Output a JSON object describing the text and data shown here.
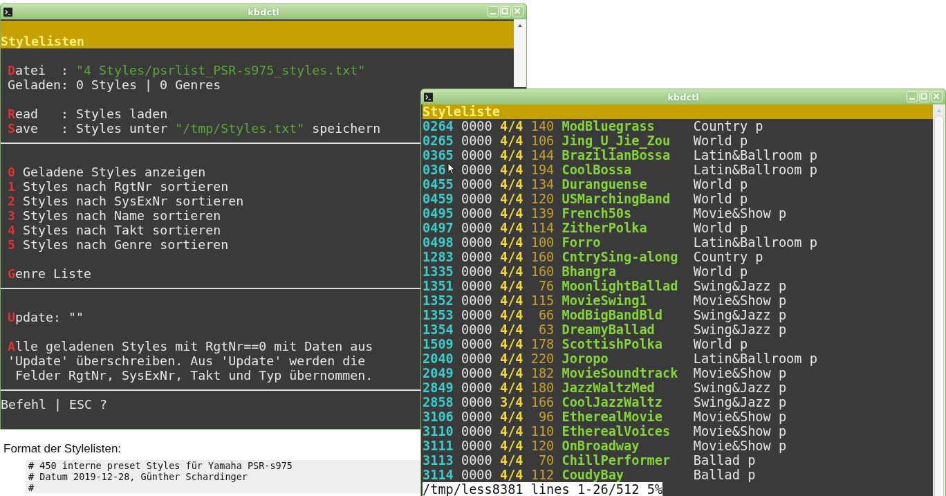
{
  "left_window": {
    "title": "kbdctl",
    "header": "Stylelisten",
    "sections": [
      {
        "groups": [
          [
            [
              {
                "kind": "hotkey",
                "text": "D"
              },
              {
                "kind": "text",
                "text": "atei  : "
              },
              {
                "kind": "path",
                "text": "\"4 Styles/psrlist_PSR-s975_styles.txt\""
              }
            ],
            [
              {
                "kind": "text",
                "text": "Geladen: 0 Styles | 0 Genres"
              }
            ]
          ],
          [
            [
              {
                "kind": "hotkey",
                "text": "R"
              },
              {
                "kind": "text",
                "text": "ead   : Styles laden"
              }
            ],
            [
              {
                "kind": "hotkey",
                "text": "S"
              },
              {
                "kind": "text",
                "text": "ave   : Styles unter "
              },
              {
                "kind": "path",
                "text": "\"/tmp/Styles.txt\""
              },
              {
                "kind": "text",
                "text": " speichern"
              }
            ]
          ]
        ]
      },
      {
        "groups": [
          [
            [
              {
                "kind": "hotkey",
                "text": "0"
              },
              {
                "kind": "text",
                "text": " Geladene Styles anzeigen"
              }
            ],
            [
              {
                "kind": "hotkey",
                "text": "1"
              },
              {
                "kind": "text",
                "text": " Styles nach RgtNr sortieren"
              }
            ],
            [
              {
                "kind": "hotkey",
                "text": "2"
              },
              {
                "kind": "text",
                "text": " Styles nach SysExNr sortieren"
              }
            ],
            [
              {
                "kind": "hotkey",
                "text": "3"
              },
              {
                "kind": "text",
                "text": " Styles nach Name sortieren"
              }
            ],
            [
              {
                "kind": "hotkey",
                "text": "4"
              },
              {
                "kind": "text",
                "text": " Styles nach Takt sortieren"
              }
            ],
            [
              {
                "kind": "hotkey",
                "text": "5"
              },
              {
                "kind": "text",
                "text": " Styles nach Genre sortieren"
              }
            ]
          ],
          [
            [
              {
                "kind": "hotkey",
                "text": "G"
              },
              {
                "kind": "text",
                "text": "enre Liste"
              }
            ]
          ]
        ]
      },
      {
        "groups": [
          [
            [
              {
                "kind": "hotkey",
                "text": "U"
              },
              {
                "kind": "text",
                "text": "pdate: \"\""
              }
            ]
          ],
          [
            [
              {
                "kind": "hotkey",
                "text": "A"
              },
              {
                "kind": "text",
                "text": "lle geladenen Styles mit RgtNr==0 mit Daten aus"
              }
            ],
            [
              {
                "kind": "text",
                "text": "'Update' überschreiben. Aus 'Update' werden die"
              }
            ],
            [
              {
                "kind": "text",
                "text": " Felder RgtNr, SysExNr, Takt und Typ übernommen."
              }
            ]
          ]
        ]
      }
    ],
    "prompt": "Befehl | ESC ?"
  },
  "right_window": {
    "title": "kbdctl",
    "header": "Styleliste",
    "rows": [
      {
        "id": "0264",
        "sysex": "0000",
        "takt": "4/4",
        "tempo": "140",
        "name": "ModBluegrass",
        "genre": "Country p"
      },
      {
        "id": "0265",
        "sysex": "0000",
        "takt": "4/4",
        "tempo": "106",
        "name": "Jing_U_Jie_Zou",
        "genre": "World p"
      },
      {
        "id": "0365",
        "sysex": "0000",
        "takt": "4/4",
        "tempo": "144",
        "name": "BrazilianBossa",
        "genre": "Latin&Ballroom p"
      },
      {
        "id": "036",
        "sysex": "0000",
        "takt": "4/4",
        "tempo": "194",
        "name": "CoolBossa",
        "genre": "Latin&Ballroom p"
      },
      {
        "id": "0455",
        "sysex": "0000",
        "takt": "4/4",
        "tempo": "134",
        "name": "Duranguense",
        "genre": "World p"
      },
      {
        "id": "0459",
        "sysex": "0000",
        "takt": "4/4",
        "tempo": "120",
        "name": "USMarchingBand",
        "genre": "World p"
      },
      {
        "id": "0495",
        "sysex": "0000",
        "takt": "4/4",
        "tempo": "139",
        "name": "French50s",
        "genre": "Movie&Show p"
      },
      {
        "id": "0497",
        "sysex": "0000",
        "takt": "4/4",
        "tempo": "114",
        "name": "ZitherPolka",
        "genre": "World p"
      },
      {
        "id": "0498",
        "sysex": "0000",
        "takt": "4/4",
        "tempo": "100",
        "name": "Forro",
        "genre": "Latin&Ballroom p"
      },
      {
        "id": "1283",
        "sysex": "0000",
        "takt": "4/4",
        "tempo": "160",
        "name": "CntrySing-along",
        "genre": "Country p"
      },
      {
        "id": "1335",
        "sysex": "0000",
        "takt": "4/4",
        "tempo": "160",
        "name": "Bhangra",
        "genre": "World p"
      },
      {
        "id": "1351",
        "sysex": "0000",
        "takt": "4/4",
        "tempo": "76",
        "name": "MoonlightBallad",
        "genre": "Swing&Jazz p"
      },
      {
        "id": "1352",
        "sysex": "0000",
        "takt": "4/4",
        "tempo": "115",
        "name": "MovieSwing1",
        "genre": "Movie&Show p"
      },
      {
        "id": "1353",
        "sysex": "0000",
        "takt": "4/4",
        "tempo": "66",
        "name": "ModBigBandBld",
        "genre": "Swing&Jazz p"
      },
      {
        "id": "1354",
        "sysex": "0000",
        "takt": "4/4",
        "tempo": "63",
        "name": "DreamyBallad",
        "genre": "Swing&Jazz p"
      },
      {
        "id": "1509",
        "sysex": "0000",
        "takt": "4/4",
        "tempo": "178",
        "name": "ScottishPolka",
        "genre": "World p"
      },
      {
        "id": "2040",
        "sysex": "0000",
        "takt": "4/4",
        "tempo": "220",
        "name": "Joropo",
        "genre": "Latin&Ballroom p"
      },
      {
        "id": "2049",
        "sysex": "0000",
        "takt": "4/4",
        "tempo": "182",
        "name": "MovieSoundtrack",
        "genre": "Movie&Show p"
      },
      {
        "id": "2849",
        "sysex": "0000",
        "takt": "4/4",
        "tempo": "180",
        "name": "JazzWaltzMed",
        "genre": "Swing&Jazz p"
      },
      {
        "id": "2858",
        "sysex": "0000",
        "takt": "3/4",
        "tempo": "166",
        "name": "CoolJazzWaltz",
        "genre": "Swing&Jazz p"
      },
      {
        "id": "3106",
        "sysex": "0000",
        "takt": "4/4",
        "tempo": "96",
        "name": "EtherealMovie",
        "genre": "Movie&Show p"
      },
      {
        "id": "3110",
        "sysex": "0000",
        "takt": "4/4",
        "tempo": "110",
        "name": "EtherealVoices",
        "genre": "Movie&Show p"
      },
      {
        "id": "3111",
        "sysex": "0000",
        "takt": "4/4",
        "tempo": "120",
        "name": "OnBroadway",
        "genre": "Movie&Show p"
      },
      {
        "id": "3113",
        "sysex": "0000",
        "takt": "4/4",
        "tempo": "70",
        "name": "ChillPerformer",
        "genre": "Ballad p"
      },
      {
        "id": "3114",
        "sysex": "0000",
        "takt": "4/4",
        "tempo": "112",
        "name": "CoudyBay",
        "genre": "Ballad p"
      }
    ],
    "status": "/tmp/less8381 lines 1-26/512 5%"
  },
  "document": {
    "heading": "Format der Stylelisten:",
    "code_lines": [
      "# 450 interne preset Styles für Yamaha PSR-s975",
      "# Datum 2019-12-28, Günther Schardinger",
      "#"
    ]
  }
}
